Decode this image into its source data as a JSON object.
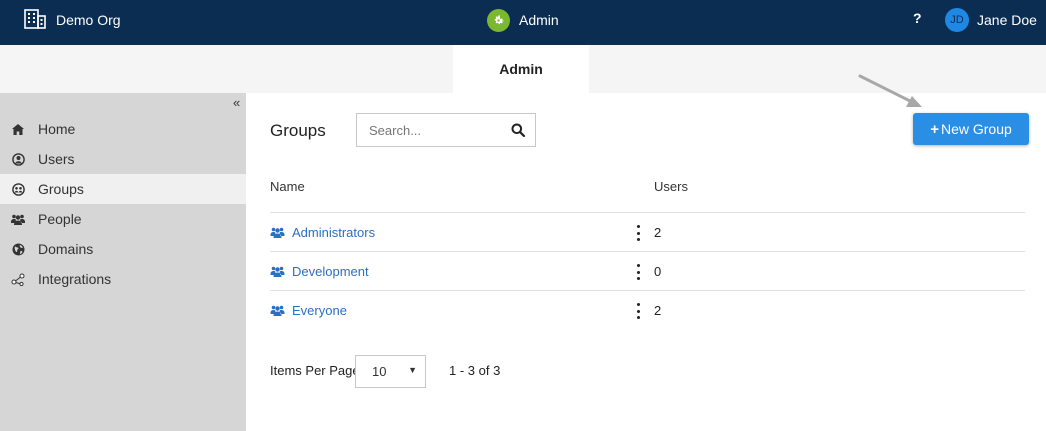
{
  "header": {
    "org_name": "Demo Org",
    "app_name": "Admin",
    "help_label": "?",
    "user_initials": "JD",
    "user_name": "Jane Doe"
  },
  "tabs": [
    {
      "label": "Admin",
      "active": true
    }
  ],
  "sidebar": {
    "collapse_label": "«",
    "items": [
      {
        "label": "Home",
        "icon": "home-icon"
      },
      {
        "label": "Users",
        "icon": "user-circle-icon"
      },
      {
        "label": "Groups",
        "icon": "group-circle-icon",
        "active": true
      },
      {
        "label": "People",
        "icon": "people-icon"
      },
      {
        "label": "Domains",
        "icon": "globe-icon"
      },
      {
        "label": "Integrations",
        "icon": "integrations-icon"
      }
    ]
  },
  "main": {
    "title": "Groups",
    "search_placeholder": "Search...",
    "new_button_label": "New Group",
    "columns": {
      "name": "Name",
      "users": "Users"
    },
    "rows": [
      {
        "name": "Administrators",
        "users": "2"
      },
      {
        "name": "Development",
        "users": "0"
      },
      {
        "name": "Everyone",
        "users": "2"
      }
    ],
    "pager": {
      "label": "Items Per Page",
      "per_page": "10",
      "range": "1 - 3 of 3"
    }
  },
  "colors": {
    "header_bg": "#0b2d52",
    "accent": "#2a8ee5",
    "link": "#2b6fc2",
    "app_icon": "#7cb82f"
  }
}
